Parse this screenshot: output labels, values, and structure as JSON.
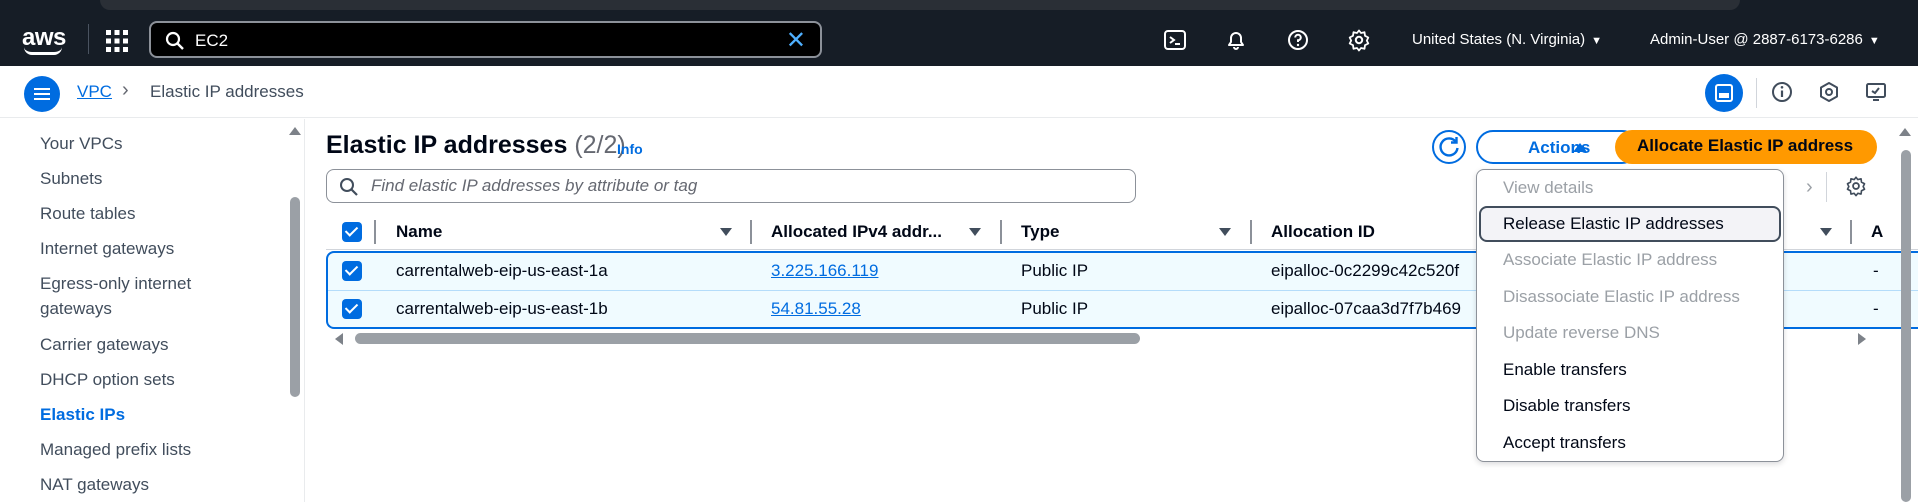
{
  "topnav": {
    "logo": "aws",
    "search_value": "EC2",
    "region": "United States (N. Virginia)",
    "account": "Admin-User @ 2887-6173-6286",
    "icons": [
      "grid-icon",
      "search-icon",
      "clear-icon",
      "cloudshell-icon",
      "bell-icon",
      "help-icon",
      "gear-icon"
    ]
  },
  "breadcrumb": {
    "root": "VPC",
    "current": "Elastic IP addresses"
  },
  "sidebar": {
    "items": [
      {
        "label": "Your VPCs"
      },
      {
        "label": "Subnets"
      },
      {
        "label": "Route tables"
      },
      {
        "label": "Internet gateways"
      },
      {
        "label": "Egress-only internet gateways"
      },
      {
        "label": "Carrier gateways"
      },
      {
        "label": "DHCP option sets"
      },
      {
        "label": "Elastic IPs"
      },
      {
        "label": "Managed prefix lists"
      },
      {
        "label": "NAT gateways"
      }
    ],
    "active": "Elastic IPs"
  },
  "main": {
    "title": "Elastic IP addresses",
    "count": "(2/2)",
    "info": "Info",
    "actions_label": "Actions",
    "allocate_label": "Allocate Elastic IP address",
    "search_placeholder": "Find elastic IP addresses by attribute or tag"
  },
  "table": {
    "columns": [
      "Name",
      "Allocated IPv4 addr...",
      "Type",
      "Allocation ID"
    ],
    "rows": [
      {
        "name": "carrentalweb-eip-us-east-1a",
        "ip": "3.225.166.119",
        "type": "Public IP",
        "allocation_id": "eipalloc-0c2299c42c520f",
        "extra": "-"
      },
      {
        "name": "carrentalweb-eip-us-east-1b",
        "ip": "54.81.55.28",
        "type": "Public IP",
        "allocation_id": "eipalloc-07caa3d7f7b469",
        "extra": "-"
      }
    ],
    "partial_header": "A"
  },
  "actions_menu": {
    "items": [
      {
        "label": "View details",
        "enabled": false
      },
      {
        "label": "Release Elastic IP addresses",
        "enabled": true
      },
      {
        "label": "Associate Elastic IP address",
        "enabled": false
      },
      {
        "label": "Disassociate Elastic IP address",
        "enabled": false
      },
      {
        "label": "Update reverse DNS",
        "enabled": false
      },
      {
        "label": "Enable transfers",
        "enabled": true
      },
      {
        "label": "Disable transfers",
        "enabled": true
      },
      {
        "label": "Accept transfers",
        "enabled": true
      }
    ],
    "highlighted": "Release Elastic IP addresses"
  },
  "colors": {
    "nav_bg": "#161d26",
    "link": "#006ce0",
    "primary_button": "#ff9900",
    "selected_row_bg": "#f0fbff"
  }
}
